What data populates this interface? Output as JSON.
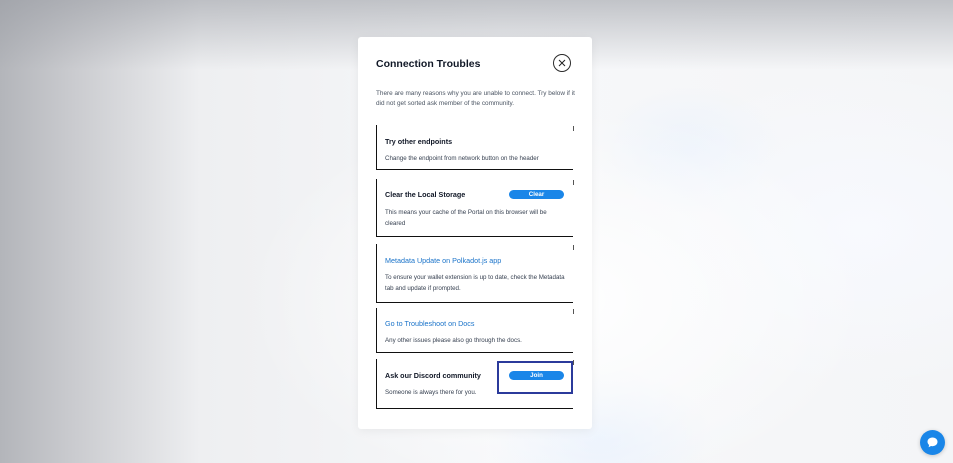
{
  "modal": {
    "title": "Connection Troubles",
    "intro": "There are many reasons why you are unable to connect. Try below if it did not get sorted ask member of the community.",
    "close_icon": "close-icon"
  },
  "cards": [
    {
      "title": "Try other endpoints",
      "description": "Change the endpoint from network button on the header"
    },
    {
      "title": "Clear the Local Storage",
      "description": "This means your cache of the Portal on this browser will be cleared",
      "button_label": "Clear"
    },
    {
      "title": "Metadata Update on Polkadot.js app",
      "description": "To ensure your wallet extension is up to date, check the Metadata tab and update if prompted."
    },
    {
      "title": "Go to Troubleshoot on Docs",
      "description": "Any other issues please also go through the docs."
    },
    {
      "title": "Ask our Discord community",
      "description": "Someone is always there for you.",
      "button_label": "Join"
    }
  ],
  "chat": {
    "icon": "chat-bubble-icon",
    "color": "#1a86e8"
  },
  "colors": {
    "accent": "#1a86e8",
    "link": "#1a73c9",
    "focus_outline": "#2b3a9b"
  }
}
